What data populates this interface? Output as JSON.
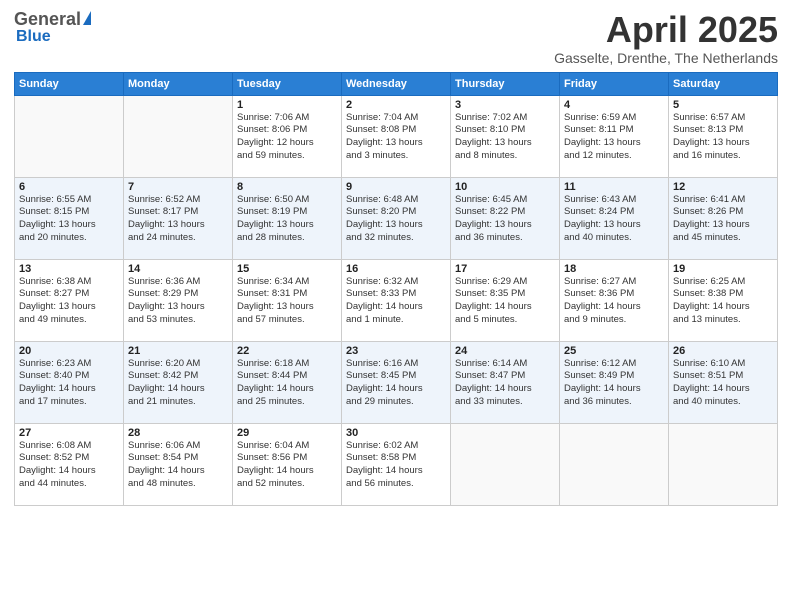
{
  "header": {
    "logo_general": "General",
    "logo_blue": "Blue",
    "title": "April 2025",
    "location": "Gasselte, Drenthe, The Netherlands"
  },
  "days_of_week": [
    "Sunday",
    "Monday",
    "Tuesday",
    "Wednesday",
    "Thursday",
    "Friday",
    "Saturday"
  ],
  "weeks": [
    [
      {
        "day": "",
        "info": ""
      },
      {
        "day": "",
        "info": ""
      },
      {
        "day": "1",
        "info": "Sunrise: 7:06 AM\nSunset: 8:06 PM\nDaylight: 12 hours\nand 59 minutes."
      },
      {
        "day": "2",
        "info": "Sunrise: 7:04 AM\nSunset: 8:08 PM\nDaylight: 13 hours\nand 3 minutes."
      },
      {
        "day": "3",
        "info": "Sunrise: 7:02 AM\nSunset: 8:10 PM\nDaylight: 13 hours\nand 8 minutes."
      },
      {
        "day": "4",
        "info": "Sunrise: 6:59 AM\nSunset: 8:11 PM\nDaylight: 13 hours\nand 12 minutes."
      },
      {
        "day": "5",
        "info": "Sunrise: 6:57 AM\nSunset: 8:13 PM\nDaylight: 13 hours\nand 16 minutes."
      }
    ],
    [
      {
        "day": "6",
        "info": "Sunrise: 6:55 AM\nSunset: 8:15 PM\nDaylight: 13 hours\nand 20 minutes."
      },
      {
        "day": "7",
        "info": "Sunrise: 6:52 AM\nSunset: 8:17 PM\nDaylight: 13 hours\nand 24 minutes."
      },
      {
        "day": "8",
        "info": "Sunrise: 6:50 AM\nSunset: 8:19 PM\nDaylight: 13 hours\nand 28 minutes."
      },
      {
        "day": "9",
        "info": "Sunrise: 6:48 AM\nSunset: 8:20 PM\nDaylight: 13 hours\nand 32 minutes."
      },
      {
        "day": "10",
        "info": "Sunrise: 6:45 AM\nSunset: 8:22 PM\nDaylight: 13 hours\nand 36 minutes."
      },
      {
        "day": "11",
        "info": "Sunrise: 6:43 AM\nSunset: 8:24 PM\nDaylight: 13 hours\nand 40 minutes."
      },
      {
        "day": "12",
        "info": "Sunrise: 6:41 AM\nSunset: 8:26 PM\nDaylight: 13 hours\nand 45 minutes."
      }
    ],
    [
      {
        "day": "13",
        "info": "Sunrise: 6:38 AM\nSunset: 8:27 PM\nDaylight: 13 hours\nand 49 minutes."
      },
      {
        "day": "14",
        "info": "Sunrise: 6:36 AM\nSunset: 8:29 PM\nDaylight: 13 hours\nand 53 minutes."
      },
      {
        "day": "15",
        "info": "Sunrise: 6:34 AM\nSunset: 8:31 PM\nDaylight: 13 hours\nand 57 minutes."
      },
      {
        "day": "16",
        "info": "Sunrise: 6:32 AM\nSunset: 8:33 PM\nDaylight: 14 hours\nand 1 minute."
      },
      {
        "day": "17",
        "info": "Sunrise: 6:29 AM\nSunset: 8:35 PM\nDaylight: 14 hours\nand 5 minutes."
      },
      {
        "day": "18",
        "info": "Sunrise: 6:27 AM\nSunset: 8:36 PM\nDaylight: 14 hours\nand 9 minutes."
      },
      {
        "day": "19",
        "info": "Sunrise: 6:25 AM\nSunset: 8:38 PM\nDaylight: 14 hours\nand 13 minutes."
      }
    ],
    [
      {
        "day": "20",
        "info": "Sunrise: 6:23 AM\nSunset: 8:40 PM\nDaylight: 14 hours\nand 17 minutes."
      },
      {
        "day": "21",
        "info": "Sunrise: 6:20 AM\nSunset: 8:42 PM\nDaylight: 14 hours\nand 21 minutes."
      },
      {
        "day": "22",
        "info": "Sunrise: 6:18 AM\nSunset: 8:44 PM\nDaylight: 14 hours\nand 25 minutes."
      },
      {
        "day": "23",
        "info": "Sunrise: 6:16 AM\nSunset: 8:45 PM\nDaylight: 14 hours\nand 29 minutes."
      },
      {
        "day": "24",
        "info": "Sunrise: 6:14 AM\nSunset: 8:47 PM\nDaylight: 14 hours\nand 33 minutes."
      },
      {
        "day": "25",
        "info": "Sunrise: 6:12 AM\nSunset: 8:49 PM\nDaylight: 14 hours\nand 36 minutes."
      },
      {
        "day": "26",
        "info": "Sunrise: 6:10 AM\nSunset: 8:51 PM\nDaylight: 14 hours\nand 40 minutes."
      }
    ],
    [
      {
        "day": "27",
        "info": "Sunrise: 6:08 AM\nSunset: 8:52 PM\nDaylight: 14 hours\nand 44 minutes."
      },
      {
        "day": "28",
        "info": "Sunrise: 6:06 AM\nSunset: 8:54 PM\nDaylight: 14 hours\nand 48 minutes."
      },
      {
        "day": "29",
        "info": "Sunrise: 6:04 AM\nSunset: 8:56 PM\nDaylight: 14 hours\nand 52 minutes."
      },
      {
        "day": "30",
        "info": "Sunrise: 6:02 AM\nSunset: 8:58 PM\nDaylight: 14 hours\nand 56 minutes."
      },
      {
        "day": "",
        "info": ""
      },
      {
        "day": "",
        "info": ""
      },
      {
        "day": "",
        "info": ""
      }
    ]
  ]
}
